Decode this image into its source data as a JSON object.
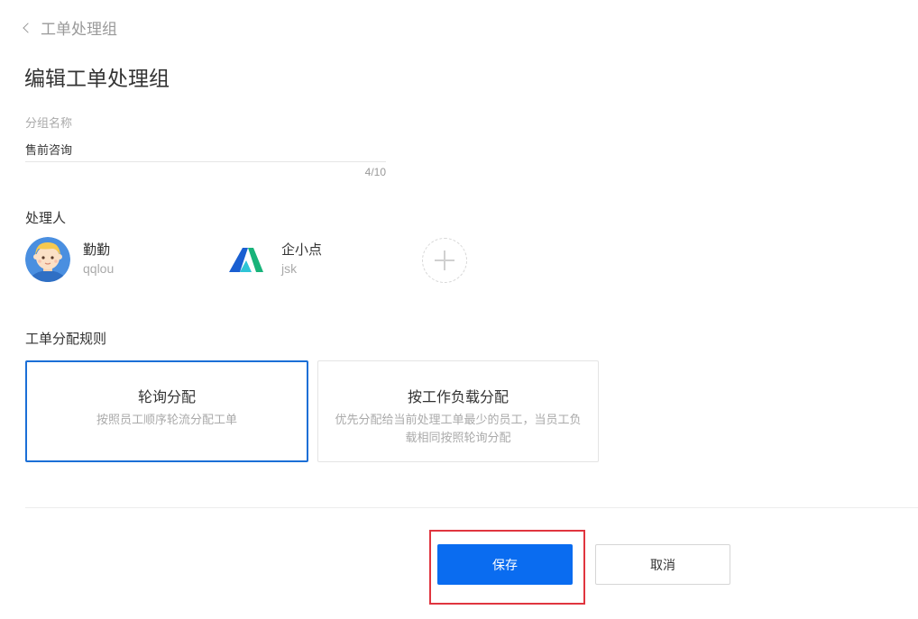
{
  "header": {
    "back_label": "工单处理组",
    "page_title": "编辑工单处理组"
  },
  "group_name": {
    "label": "分组名称",
    "value": "售前咨询",
    "counter": "4/10"
  },
  "handlers": {
    "label": "处理人",
    "items": [
      {
        "name": "勤勤",
        "account": "qqlou",
        "avatar_icon": "cartoon-avatar-icon"
      },
      {
        "name": "企小点",
        "account": "jsk",
        "avatar_icon": "brand-logo-icon"
      }
    ],
    "add_icon": "plus-icon"
  },
  "assignment_rule": {
    "label": "工单分配规则",
    "options": [
      {
        "title": "轮询分配",
        "description": "按照员工顺序轮流分配工单",
        "selected": true
      },
      {
        "title": "按工作负载分配",
        "description": "优先分配给当前处理工单最少的员工，当员工负载相同按照轮询分配",
        "selected": false
      }
    ]
  },
  "footer": {
    "save_label": "保存",
    "cancel_label": "取消"
  },
  "colors": {
    "accent": "#0a6cf0",
    "selected_border": "#1b6fd6",
    "highlight": "#e0353f"
  }
}
